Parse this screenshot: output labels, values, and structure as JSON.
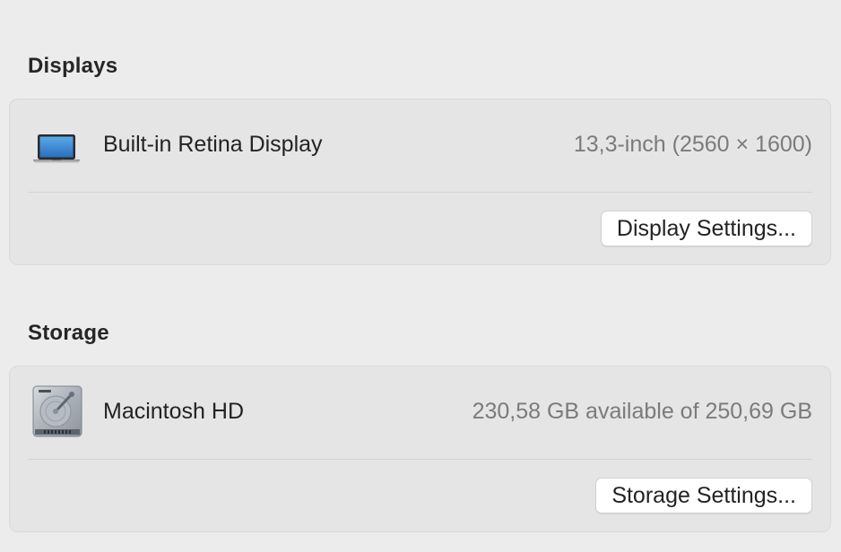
{
  "displays": {
    "heading": "Displays",
    "items": [
      {
        "icon": "laptop-icon",
        "name": "Built-in Retina Display",
        "detail": "13,3-inch (2560 × 1600)"
      }
    ],
    "settings_button": "Display Settings..."
  },
  "storage": {
    "heading": "Storage",
    "items": [
      {
        "icon": "hard-drive-icon",
        "name": "Macintosh HD",
        "detail": "230,58 GB available of 250,69 GB"
      }
    ],
    "settings_button": "Storage Settings..."
  }
}
